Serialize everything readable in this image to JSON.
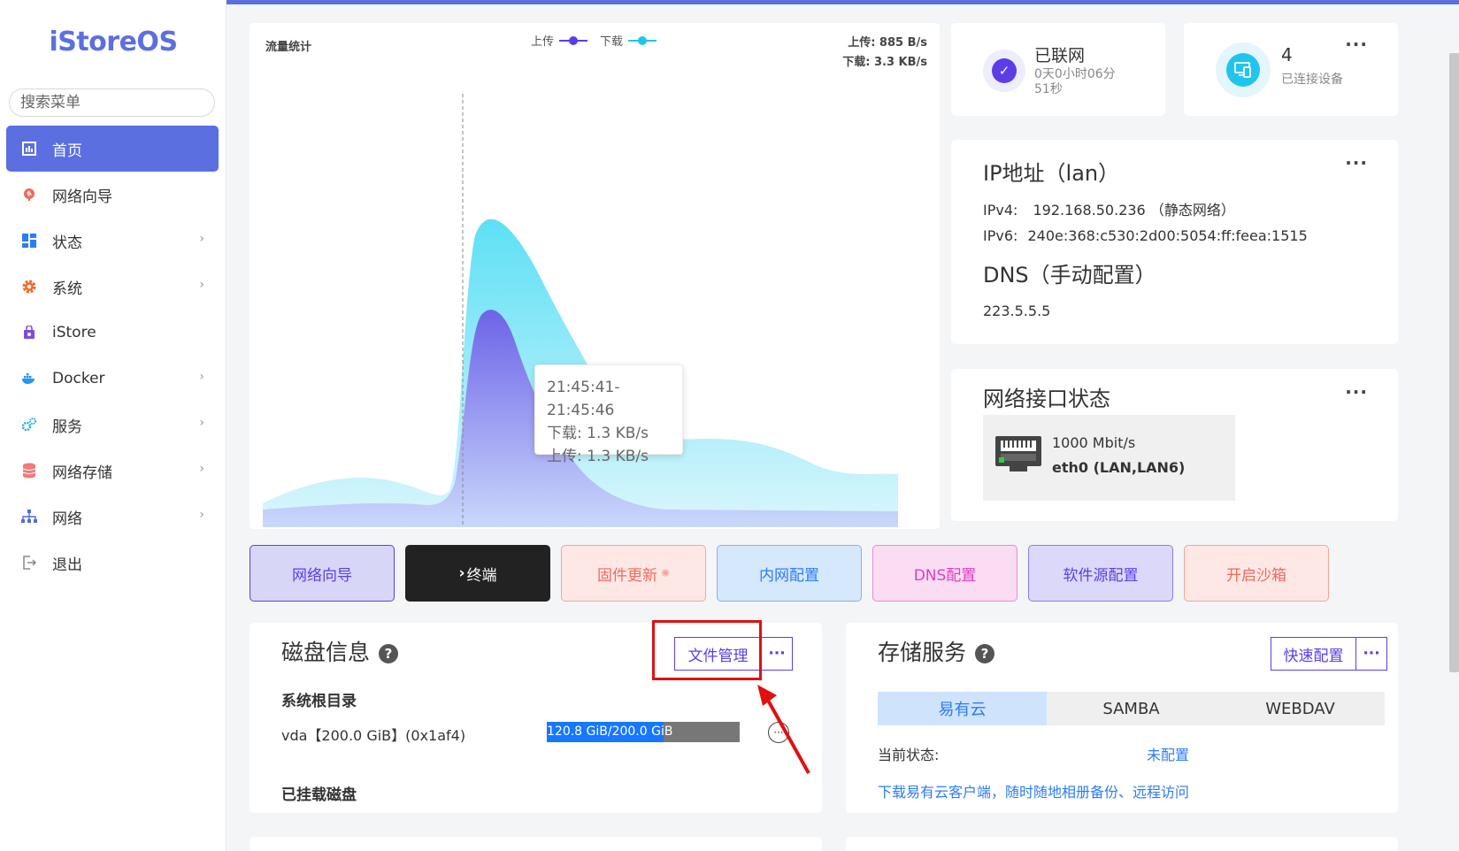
{
  "app": {
    "logo": "iStoreOS"
  },
  "sidebar": {
    "search_placeholder": "搜索菜单",
    "items": [
      {
        "label": "首页",
        "icon": "home-icon",
        "active": true,
        "has_submenu": false
      },
      {
        "label": "网络向导",
        "icon": "wizard-icon",
        "has_submenu": false
      },
      {
        "label": "状态",
        "icon": "dashboard-icon",
        "has_submenu": true
      },
      {
        "label": "系统",
        "icon": "gear-icon",
        "has_submenu": true
      },
      {
        "label": "iStore",
        "icon": "store-bag-icon",
        "has_submenu": false
      },
      {
        "label": "Docker",
        "icon": "docker-whale-icon",
        "has_submenu": true
      },
      {
        "label": "服务",
        "icon": "cogs-icon",
        "has_submenu": true
      },
      {
        "label": "网络存储",
        "icon": "database-icon",
        "has_submenu": true
      },
      {
        "label": "网络",
        "icon": "network-tree-icon",
        "has_submenu": true
      },
      {
        "label": "退出",
        "icon": "logout-icon",
        "has_submenu": false
      }
    ]
  },
  "traffic": {
    "title": "流量统计",
    "legend_upload": "上传",
    "legend_download": "下载",
    "upload_rate": "上传: 885 B/s",
    "download_rate": "下载: 3.3 KB/s",
    "tooltip": {
      "time": "21:45:41-21:45:46",
      "download": "下载: 1.3 KB/s",
      "upload": "上传: 1.3 KB/s"
    },
    "colors": {
      "upload": "#5b3ee8",
      "download": "#20c5ee"
    }
  },
  "connection": {
    "status": "已联网",
    "uptime": "0天0小时06分51秒"
  },
  "devices": {
    "count": "4",
    "label": "已连接设备"
  },
  "ip_card": {
    "title": "IP地址（lan）",
    "ipv4_label": "IPv4:",
    "ipv4_value": "192.168.50.236 （静态网络）",
    "ipv6_label": "IPv6:",
    "ipv6_value": "240e:368:c530:2d00:5054:ff:feea:1515",
    "dns_title": "DNS（手动配置）",
    "dns_value": "223.5.5.5"
  },
  "iface_card": {
    "title": "网络接口状态",
    "speed": "1000 Mbit/s",
    "name": "eth0 (LAN,LAN6)"
  },
  "quick_buttons": [
    {
      "label": "网络向导",
      "bg": "#d8d6f7",
      "border": "#5b3ee8",
      "color": "#5b3ee8"
    },
    {
      "label": "终端",
      "bg": "#222222",
      "border": "#222222",
      "color": "#ffffff"
    },
    {
      "label": "固件更新",
      "bg": "#fde8e6",
      "border": "#f3a59c",
      "color": "#f06a5a"
    },
    {
      "label": "内网配置",
      "bg": "#d6e8fb",
      "border": "#7fb4f0",
      "color": "#2c7cf6"
    },
    {
      "label": "DNS配置",
      "bg": "#fadcf3",
      "border": "#ee88d8",
      "color": "#e23bbf"
    },
    {
      "label": "软件源配置",
      "bg": "#dcd8f9",
      "border": "#8d7be8",
      "color": "#5b3ee8"
    },
    {
      "label": "开启沙箱",
      "bg": "#fde8e6",
      "border": "#f3a59c",
      "color": "#f06a5a"
    }
  ],
  "disk": {
    "title": "磁盘信息",
    "file_manage": "文件管理",
    "root_label": "系统根目录",
    "vda_label": "vda【200.0 GiB】(0x1af4)",
    "usage_text": "120.8 GiB/200.0 GiB",
    "usage_fraction": 0.604,
    "mounted_label": "已挂载磁盘"
  },
  "storage": {
    "title": "存储服务",
    "quick_config": "快速配置",
    "tabs": [
      "易有云",
      "SAMBA",
      "WEBDAV"
    ],
    "status_label": "当前状态:",
    "status_value": "未配置",
    "link_text": "下载易有云客户端，随时随地相册备份、远程访问"
  }
}
